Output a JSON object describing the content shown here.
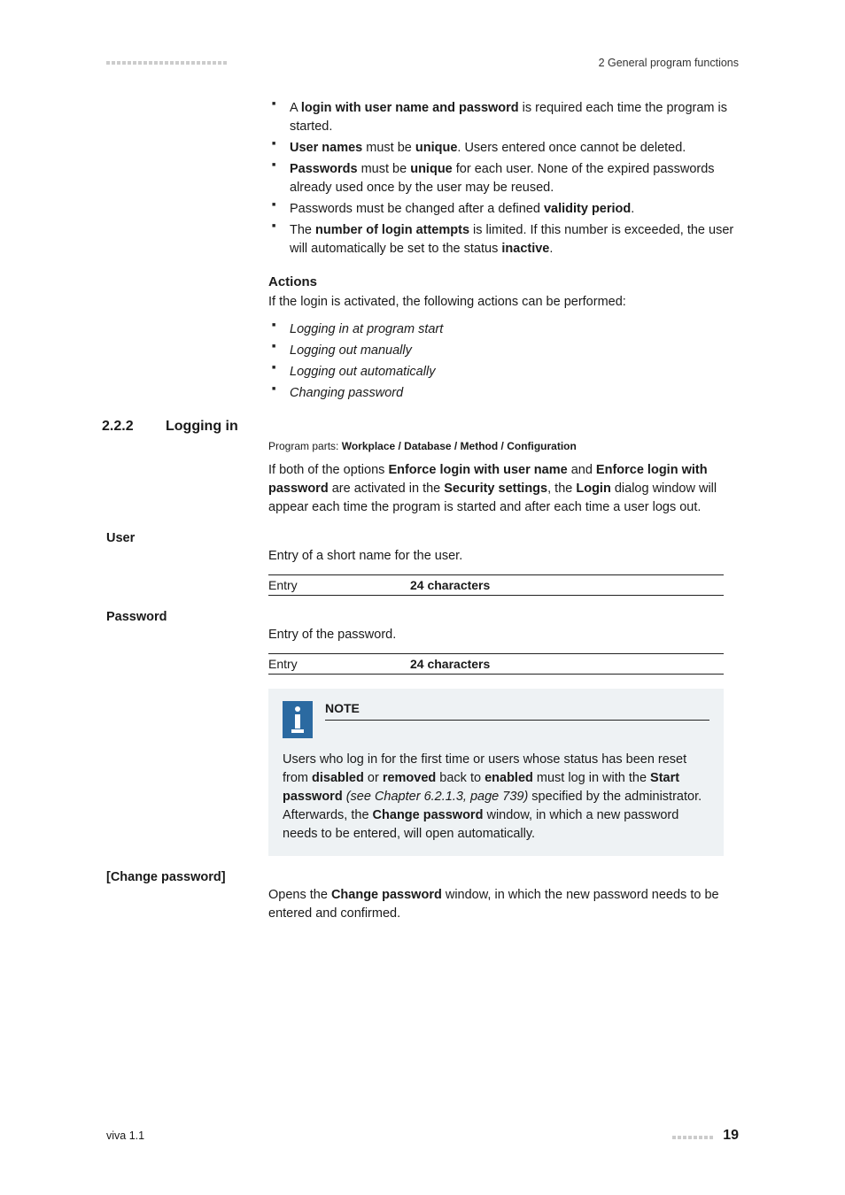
{
  "header": {
    "section_path": "2 General program functions"
  },
  "intro_bullets": [
    {
      "pre": "A ",
      "b1": "login with user name and password",
      "post1": " is required each time the program is started."
    },
    {
      "b1": "User names",
      "mid": " must be ",
      "b2": "unique",
      "post1": ". Users entered once cannot be deleted."
    },
    {
      "b1": "Passwords",
      "mid": " must be ",
      "b2": "unique",
      "post1": " for each user. None of the expired pass­words already used once by the user may be reused."
    },
    {
      "pre": "Passwords must be changed after a defined ",
      "b1": "validity period",
      "post1": "."
    },
    {
      "pre": "The ",
      "b1": "number of login attempts",
      "post1": " is limited. If this number is exceeded, the user will automatically be set to the status ",
      "b2": "inactive",
      "post2": "."
    }
  ],
  "actions": {
    "heading": "Actions",
    "lead": "If the login is activated, the following actions can be performed:",
    "items": [
      "Logging in at program start",
      "Logging out manually",
      "Logging out automatically",
      "Changing password"
    ]
  },
  "section": {
    "num": "2.2.2",
    "title": "Logging in",
    "program_parts_label": "Program parts: ",
    "program_parts_value": "Workplace / Database / Method / Configuration",
    "body_pre": "If both of the options ",
    "b1": "Enforce login with user name",
    "mid1": " and ",
    "b2": "Enforce login with password",
    "mid2": " are activated in the ",
    "b3": "Security settings",
    "mid3": ", the ",
    "b4": "Login",
    "post": " dialog window will appear each time the program is started and after each time a user logs out."
  },
  "user": {
    "label": "User",
    "desc": "Entry of a short name for the user.",
    "entry_label": "Entry",
    "entry_value": "24 characters"
  },
  "password": {
    "label": "Password",
    "desc": "Entry of the password.",
    "entry_label": "Entry",
    "entry_value": "24 characters"
  },
  "note": {
    "title": "NOTE",
    "body_pre": "Users who log in for the first time or users whose status has been reset from ",
    "b1": "disabled",
    "mid1": " or ",
    "b2": "removed",
    "mid2": " back to ",
    "b3": "enabled",
    "mid3": " must log in with the ",
    "b4": "Start password",
    "i1": " (see Chapter 6.2.1.3, page 739)",
    "mid4": " specified by the administrator. Afterwards, the ",
    "b5": "Change password",
    "post": " window, in which a new password needs to be entered, will open automatically."
  },
  "change_pw": {
    "label": "[Change password]",
    "desc_pre": "Opens the ",
    "b1": "Change password",
    "desc_post": " window, in which the new password needs to be entered and confirmed."
  },
  "footer": {
    "left": "viva 1.1",
    "page": "19"
  }
}
